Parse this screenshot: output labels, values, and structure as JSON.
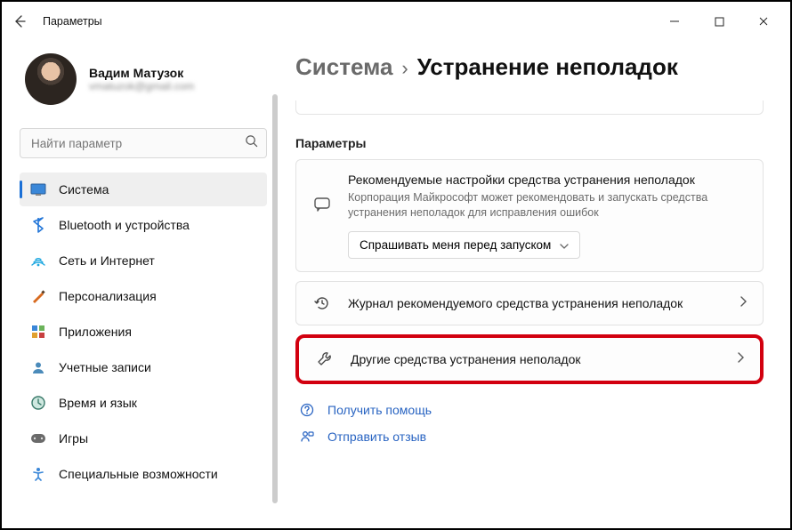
{
  "window": {
    "title": "Параметры"
  },
  "profile": {
    "name": "Вадим Матузок",
    "email": "vmatuzok@gmail.com"
  },
  "search": {
    "placeholder": "Найти параметр"
  },
  "sidebar": {
    "items": [
      {
        "label": "Система",
        "icon": "system"
      },
      {
        "label": "Bluetooth и устройства",
        "icon": "bluetooth"
      },
      {
        "label": "Сеть и Интернет",
        "icon": "network"
      },
      {
        "label": "Персонализация",
        "icon": "personalization"
      },
      {
        "label": "Приложения",
        "icon": "apps"
      },
      {
        "label": "Учетные записи",
        "icon": "accounts"
      },
      {
        "label": "Время и язык",
        "icon": "time"
      },
      {
        "label": "Игры",
        "icon": "gaming"
      },
      {
        "label": "Специальные возможности",
        "icon": "accessibility"
      }
    ]
  },
  "breadcrumb": {
    "root": "Система",
    "sep": "›",
    "leaf": "Устранение неполадок"
  },
  "main": {
    "section_label": "Параметры",
    "reco": {
      "title": "Рекомендуемые настройки средства устранения неполадок",
      "sub": "Корпорация Майкрософт может рекомендовать и запускать средства устранения неполадок для исправления ошибок",
      "dropdown": "Спрашивать меня перед запуском"
    },
    "history": {
      "title": "Журнал рекомендуемого средства устранения неполадок"
    },
    "other": {
      "title": "Другие средства устранения неполадок"
    }
  },
  "links": {
    "help": "Получить помощь",
    "feedback": "Отправить отзыв"
  }
}
